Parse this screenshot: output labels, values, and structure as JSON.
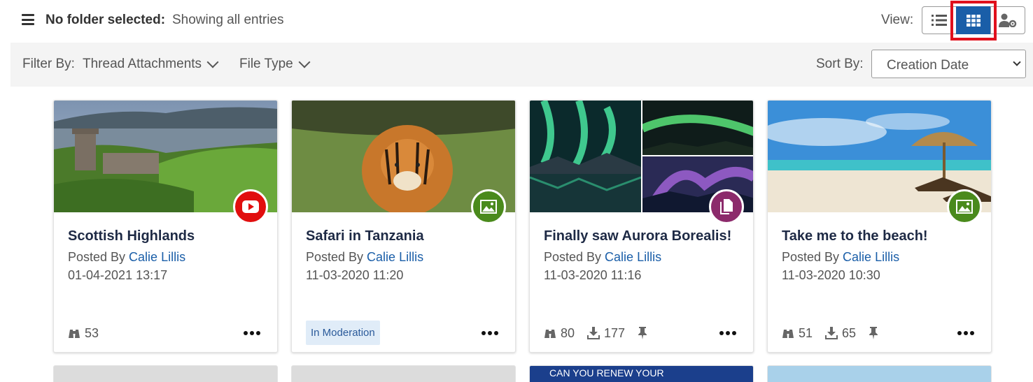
{
  "header": {
    "folder_label": "No folder selected:",
    "folder_sub": "Showing all entries",
    "view_label": "View:",
    "view_modes": [
      "list-icon",
      "grid-icon",
      "user-settings-icon"
    ],
    "active_view": "grid"
  },
  "filters": {
    "label": "Filter By:",
    "items": [
      "Thread Attachments",
      "File Type"
    ],
    "sort_label": "Sort By:",
    "sort_value": "Creation Date"
  },
  "cards": [
    {
      "title": "Scottish Highlands",
      "posted_prefix": "Posted By ",
      "author": "Calie Lillis",
      "date": "01-04-2021 13:17",
      "type_icon": "youtube-icon",
      "views": "53"
    },
    {
      "title": "Safari in Tanzania",
      "posted_prefix": "Posted By ",
      "author": "Calie Lillis",
      "date": "11-03-2020 11:20",
      "type_icon": "image-icon",
      "status": "In Moderation"
    },
    {
      "title": "Finally saw Aurora Borealis!",
      "posted_prefix": "Posted By ",
      "author": "Calie Lillis",
      "date": "11-03-2020 11:16",
      "type_icon": "documents-icon",
      "views": "80",
      "downloads": "177",
      "pinned": true
    },
    {
      "title": "Take me to the beach!",
      "posted_prefix": "Posted By ",
      "author": "Calie Lillis",
      "date": "11-03-2020 10:30",
      "type_icon": "image-icon",
      "views": "51",
      "downloads": "65",
      "pinned": true
    }
  ],
  "partial_row": {
    "card3_text": "CAN YOU RENEW YOUR"
  },
  "colors": {
    "accent": "#1a5ea8",
    "youtube": "#e10e0e",
    "image_badge": "#4a8a1c",
    "docs_badge": "#8c2a6b",
    "highlight": "#e0101c"
  }
}
